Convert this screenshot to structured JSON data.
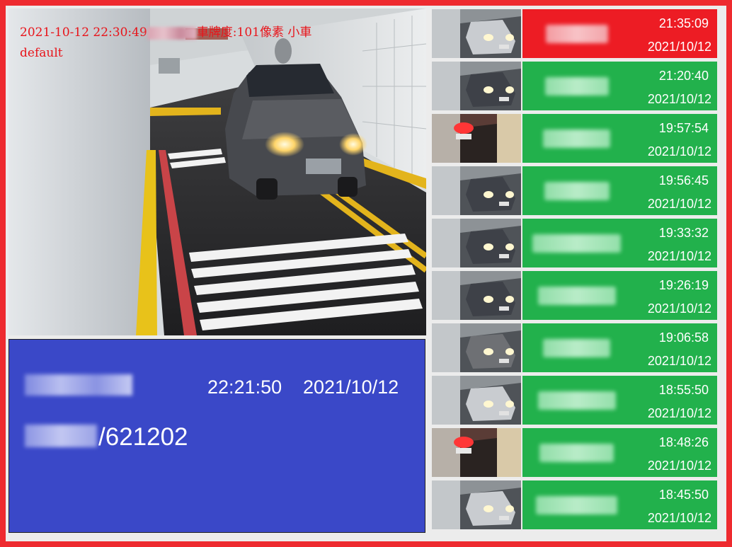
{
  "main_view": {
    "overlay_timestamp": "2021-10-12 22:30:49",
    "overlay_text": "車牌度:101像素 小車",
    "overlay_mode": "default"
  },
  "info_panel": {
    "time": "22:21:50",
    "date": "2021/10/12",
    "code_suffix": "/621202"
  },
  "records": [
    {
      "time": "21:35:09",
      "date": "2021/10/12",
      "status": "alert",
      "color": "#ed1c24",
      "thumb": "front-white"
    },
    {
      "time": "21:20:40",
      "date": "2021/10/12",
      "status": "ok",
      "color": "#22b14c",
      "thumb": "front-dark"
    },
    {
      "time": "19:57:54",
      "date": "2021/10/12",
      "status": "ok",
      "color": "#22b14c",
      "thumb": "rear-red"
    },
    {
      "time": "19:56:45",
      "date": "2021/10/12",
      "status": "ok",
      "color": "#22b14c",
      "thumb": "front-dark"
    },
    {
      "time": "19:33:32",
      "date": "2021/10/12",
      "status": "ok",
      "color": "#22b14c",
      "thumb": "front-dark"
    },
    {
      "time": "19:26:19",
      "date": "2021/10/12",
      "status": "ok",
      "color": "#22b14c",
      "thumb": "front-dark"
    },
    {
      "time": "19:06:58",
      "date": "2021/10/12",
      "status": "ok",
      "color": "#22b14c",
      "thumb": "front-grey"
    },
    {
      "time": "18:55:50",
      "date": "2021/10/12",
      "status": "ok",
      "color": "#22b14c",
      "thumb": "front-white"
    },
    {
      "time": "18:48:26",
      "date": "2021/10/12",
      "status": "ok",
      "color": "#22b14c",
      "thumb": "rear-red"
    },
    {
      "time": "18:45:50",
      "date": "2021/10/12",
      "status": "ok",
      "color": "#22b14c",
      "thumb": "front-white"
    }
  ]
}
